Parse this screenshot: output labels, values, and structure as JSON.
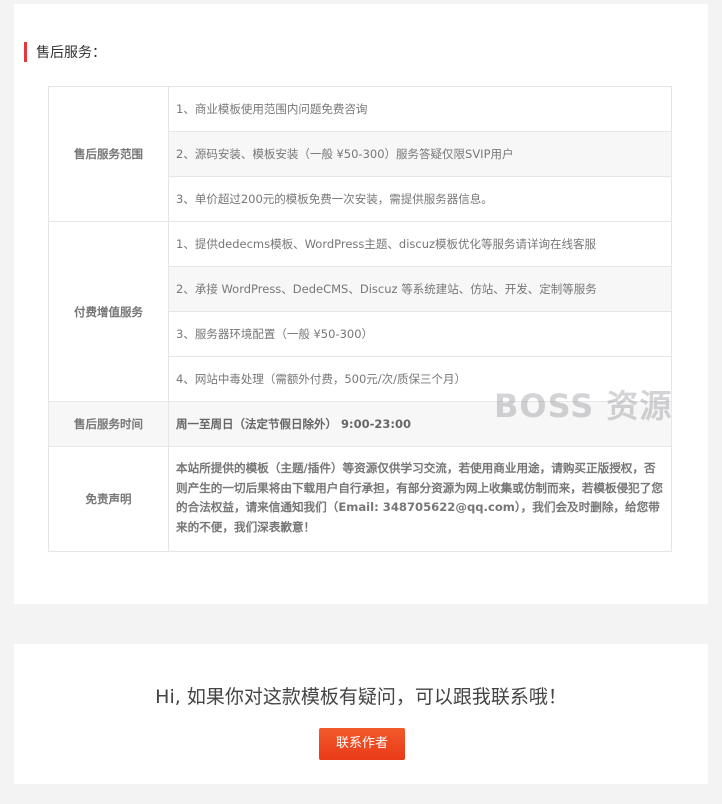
{
  "section_title": "售后服务：",
  "table": {
    "scope": {
      "label": "售后服务范围",
      "items": [
        "1、商业模板使用范围内问题免费咨询",
        "2、源码安装、模板安装（一般 ¥50-300）服务答疑仅限SVIP用户",
        "3、单价超过200元的模板免费一次安装，需提供服务器信息。"
      ]
    },
    "paid": {
      "label": "付费增值服务",
      "items": [
        "1、提供dedecms模板、WordPress主题、discuz模板优化等服务请详询在线客服",
        "2、承接 WordPress、DedeCMS、Discuz 等系统建站、仿站、开发、定制等服务",
        "3、服务器环境配置（一般 ¥50-300）",
        "4、网站中毒处理（需额外付费，500元/次/质保三个月）"
      ]
    },
    "hours": {
      "label": "售后服务时间",
      "value": "周一至周日（法定节假日除外） 9:00-23:00"
    },
    "disclaimer": {
      "label": "免责声明",
      "value": "本站所提供的模板（主题/插件）等资源仅供学习交流，若使用商业用途，请购买正版授权，否则产生的一切后果将由下载用户自行承担，有部分资源为网上收集或仿制而来，若模板侵犯了您的合法权益，请来信通知我们（Email: 348705622@qq.com），我们会及时删除，给您带来的不便，我们深表歉意！"
    }
  },
  "watermark": "BOSS 资源",
  "contact": {
    "text": "Hi, 如果你对这款模板有疑问，可以跟我联系哦！",
    "button": "联系作者"
  },
  "colors": {
    "accent": "#e4393c",
    "button": "#ee4a22"
  }
}
